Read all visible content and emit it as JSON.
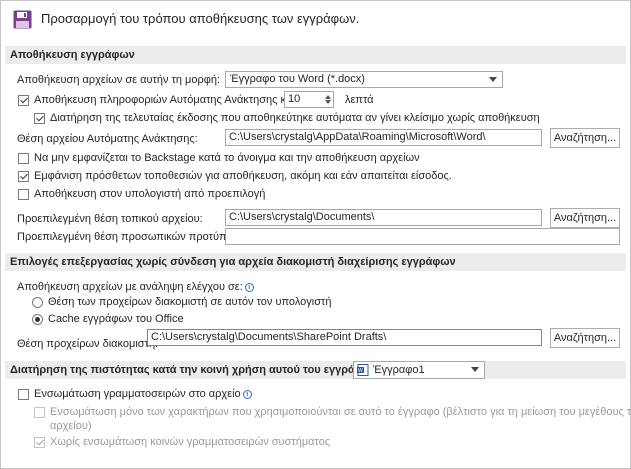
{
  "header": {
    "icon": "save-floppy-icon",
    "title": "Προσαρμογή του τρόπου αποθήκευσης των εγγράφων."
  },
  "sections": {
    "save_documents": "Αποθήκευση εγγράφων",
    "offline_editing": "Επιλογές επεξεργασίας χωρίς σύνδεση για αρχεία διακομιστή διαχείρισης εγγράφων",
    "fidelity": "Διατήρηση της πιστότητας κατά την κοινή χρήση αυτού του εγγράφου:"
  },
  "save": {
    "format_label": "Αποθήκευση αρχείων σε αυτήν τη μορφή:",
    "format_value": "Έγγραφο του Word (*.docx)",
    "autorecover_label": "Αποθήκευση πληροφοριών Αυτόματης Ανάκτησης κάθε",
    "autorecover_minutes": "10",
    "minutes_label": "λεπτά",
    "keep_last_label": "Διατήρηση της τελευταίας έκδοσης που αποθηκεύτηκε αυτόματα αν γίνει κλείσιμο χωρίς αποθήκευση",
    "autorecover_location_label": "Θέση αρχείου Αυτόματης Ανάκτησης:",
    "autorecover_location_value": "C:\\Users\\crystalg\\AppData\\Roaming\\Microsoft\\Word\\",
    "browse_label": "Αναζήτηση...",
    "no_backstage_label": "Να μην εμφανίζεται το Backstage κατά το άνοιγμα και την αποθήκευση αρχείων",
    "show_additional_label": "Εμφάνιση πρόσθετων τοποθεσιών για αποθήκευση, ακόμη και εάν απαιτείται είσοδος.",
    "save_computer_default_label": "Αποθήκευση στον υπολογιστή από προεπιλογή",
    "default_local_label": "Προεπιλεγμένη θέση τοπικού αρχείου:",
    "default_local_value": "C:\\Users\\crystalg\\Documents\\",
    "default_templates_label": "Προεπιλεγμένη θέση προσωπικών προτύπων:",
    "default_templates_value": ""
  },
  "offline": {
    "save_checked_out_label": "Αποθήκευση αρχείων με ανάληψη ελέγχου σε:",
    "server_drafts_label": "Θέση των προχείρων διακομιστή σε αυτόν τον υπολογιστή",
    "office_cache_label": "Cache εγγράφων του Office",
    "drafts_location_label": "Θέση προχείρων διακομιστή:",
    "drafts_location_value": "C:\\Users\\crystalg\\Documents\\SharePoint Drafts\\",
    "browse_label": "Αναζήτηση..."
  },
  "fidelity": {
    "document_value": "Έγγραφο1",
    "embed_fonts_label": "Ενσωμάτωση γραμματοσειρών στο αρχείο",
    "embed_only_used_label_1": "Ενσωμάτωση μόνο των χαρακτήρων που χρησιμοποιούνται σε αυτό το έγγραφο (βέλτιστο για τη μείωση του μεγέθους του",
    "embed_only_used_label_2": "αρχείου)",
    "no_common_fonts_label": "Χωρίς ενσωμάτωση κοινών γραμματοσειρών συστήματος"
  },
  "colors": {
    "section_bar": "#ececec",
    "icon_purple": "#7a3f8f",
    "info_blue": "#2a6fc9"
  }
}
